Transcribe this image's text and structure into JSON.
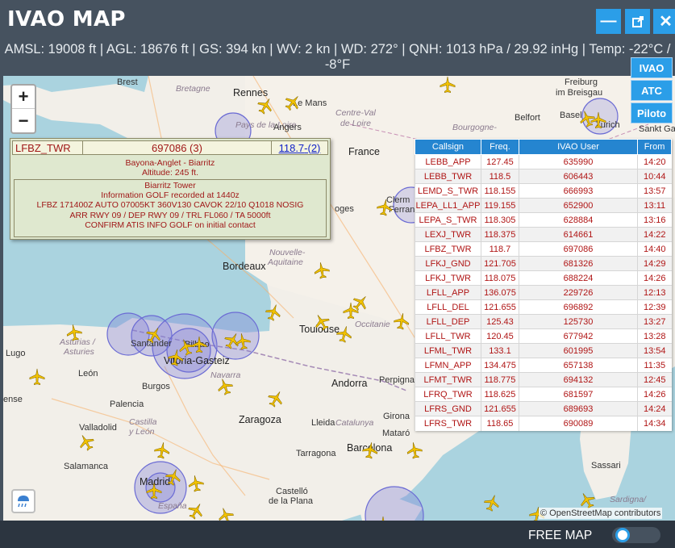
{
  "app": {
    "title": "IVAO MAP",
    "minimize_label": "—",
    "popout_label": "↗",
    "close_label": "✕"
  },
  "status": {
    "text": "AMSL: 19008 ft | AGL: 18676 ft | GS: 394 kn | WV: 2 kn | WD: 272° | QNH: 1013 hPa / 29.92 inHg | Temp: -22°C / -8°F"
  },
  "side_buttons": {
    "ivao": "IVAO",
    "atc": "ATC",
    "pilots": "Piloto"
  },
  "zoom": {
    "in": "+",
    "out": "−"
  },
  "popup": {
    "callsign": "LFBZ_TWR",
    "user_id": "697086 (3)",
    "frequency": "118.7",
    "freq_suffix": "-(2)",
    "location": "Bayona-Anglet - Biarritz",
    "altitude": "Altitude: 245 ft.",
    "atis": [
      "Biarritz Tower",
      "Information GOLF recorded at 1440z",
      "LFBZ 171400Z AUTO 07005KT 360V130 CAVOK 22/10 Q1018 NOSIG",
      "ARR RWY 09 / DEP RWY 09 / TRL FL060 / TA 5000ft",
      "CONFIRM ATIS INFO GOLF on initial contact"
    ]
  },
  "atc_table": {
    "headers": [
      "Callsign",
      "Freq.",
      "IVAO User",
      "From"
    ],
    "rows": [
      [
        "LEBB_APP",
        "127.45",
        "635990",
        "14:20"
      ],
      [
        "LEBB_TWR",
        "118.5",
        "606443",
        "10:44"
      ],
      [
        "LEMD_S_TWR",
        "118.155",
        "666993",
        "13:57"
      ],
      [
        "LEPA_LL1_APP",
        "119.155",
        "652900",
        "13:11"
      ],
      [
        "LEPA_S_TWR",
        "118.305",
        "628884",
        "13:16"
      ],
      [
        "LEXJ_TWR",
        "118.375",
        "614661",
        "14:22"
      ],
      [
        "LFBZ_TWR",
        "118.7",
        "697086",
        "14:40"
      ],
      [
        "LFKJ_GND",
        "121.705",
        "681326",
        "14:29"
      ],
      [
        "LFKJ_TWR",
        "118.075",
        "688224",
        "14:26"
      ],
      [
        "LFLL_APP",
        "136.075",
        "229726",
        "12:13"
      ],
      [
        "LFLL_DEL",
        "121.655",
        "696892",
        "12:39"
      ],
      [
        "LFLL_DEP",
        "125.43",
        "125730",
        "13:27"
      ],
      [
        "LFLL_TWR",
        "120.45",
        "677942",
        "13:28"
      ],
      [
        "LFML_TWR",
        "133.1",
        "601995",
        "13:54"
      ],
      [
        "LFMN_APP",
        "134.475",
        "657138",
        "11:35"
      ],
      [
        "LFMT_TWR",
        "118.775",
        "694132",
        "12:45"
      ],
      [
        "LFRQ_TWR",
        "118.625",
        "681597",
        "14:26"
      ],
      [
        "LFRS_GND",
        "121.655",
        "689693",
        "14:24"
      ],
      [
        "LFRS_TWR",
        "118.65",
        "690089",
        "14:34"
      ]
    ]
  },
  "map_labels": {
    "brest": "Brest",
    "bretagne": "Bretagne",
    "rennes": "Rennes",
    "le_mans": "Le Mans",
    "pays_de_la_loire": "Pays de la Loire",
    "angers": "Angers",
    "centre_val": "Centre-Val",
    "de_loire": "de Loire",
    "france": "France",
    "bourgogne": "Bourgogne-",
    "freiburg": "Freiburg",
    "im_breisgau": "im Breisgau",
    "belfort": "Belfort",
    "basel": "Basel",
    "zurich": "Zurich",
    "sankt_gall": "Sankt Gall",
    "limoges": "oges",
    "clermont": "Clerm",
    "ferrand": "Ferran",
    "bordeaux": "Bordeaux",
    "nouvelle": "Nouvelle-",
    "aquitaine": "Aquitaine",
    "toulouse": "Toulouse",
    "occitanie": "Occitanie",
    "asturias": "Asturias /",
    "asturies": "Asturies",
    "santander": "Santander",
    "bilbao": "Bilbao",
    "vitoria": "Vitoria-Gasteiz",
    "navarra": "Navarra",
    "lugo": "Lugo",
    "leon": "León",
    "burgos": "Burgos",
    "palencia": "Palencia",
    "castilla": "Castilla",
    "y_leon": "y León",
    "valladolid": "Valladolid",
    "zaragoza": "Zaragoza",
    "lleida": "Lleida",
    "catalunya": "Catalunya",
    "andorra": "Andorra",
    "perpignan": "Perpigna",
    "girona": "Girona",
    "mataro": "Mataró",
    "barcelona": "Barcelona",
    "tarragona": "Tarragona",
    "salamanca": "Salamanca",
    "madrid": "Madrid",
    "espana": "España",
    "castello": "Castelló",
    "de_la_plana": "de la Plana",
    "sassari": "Sassari",
    "sardigna": "Sardigna/",
    "ense": "ense"
  },
  "map_credit": "© OpenStreetMap contributors",
  "footer": {
    "free_map_label": "FREE MAP"
  },
  "colors": {
    "accent": "#2b9ee8",
    "header_bg": "#46525f",
    "footer_bg": "#2c3540",
    "table_header": "#2585d0",
    "table_text": "#b01515",
    "atc_circle": "#6b6bd4",
    "plane": "#f2c200"
  }
}
